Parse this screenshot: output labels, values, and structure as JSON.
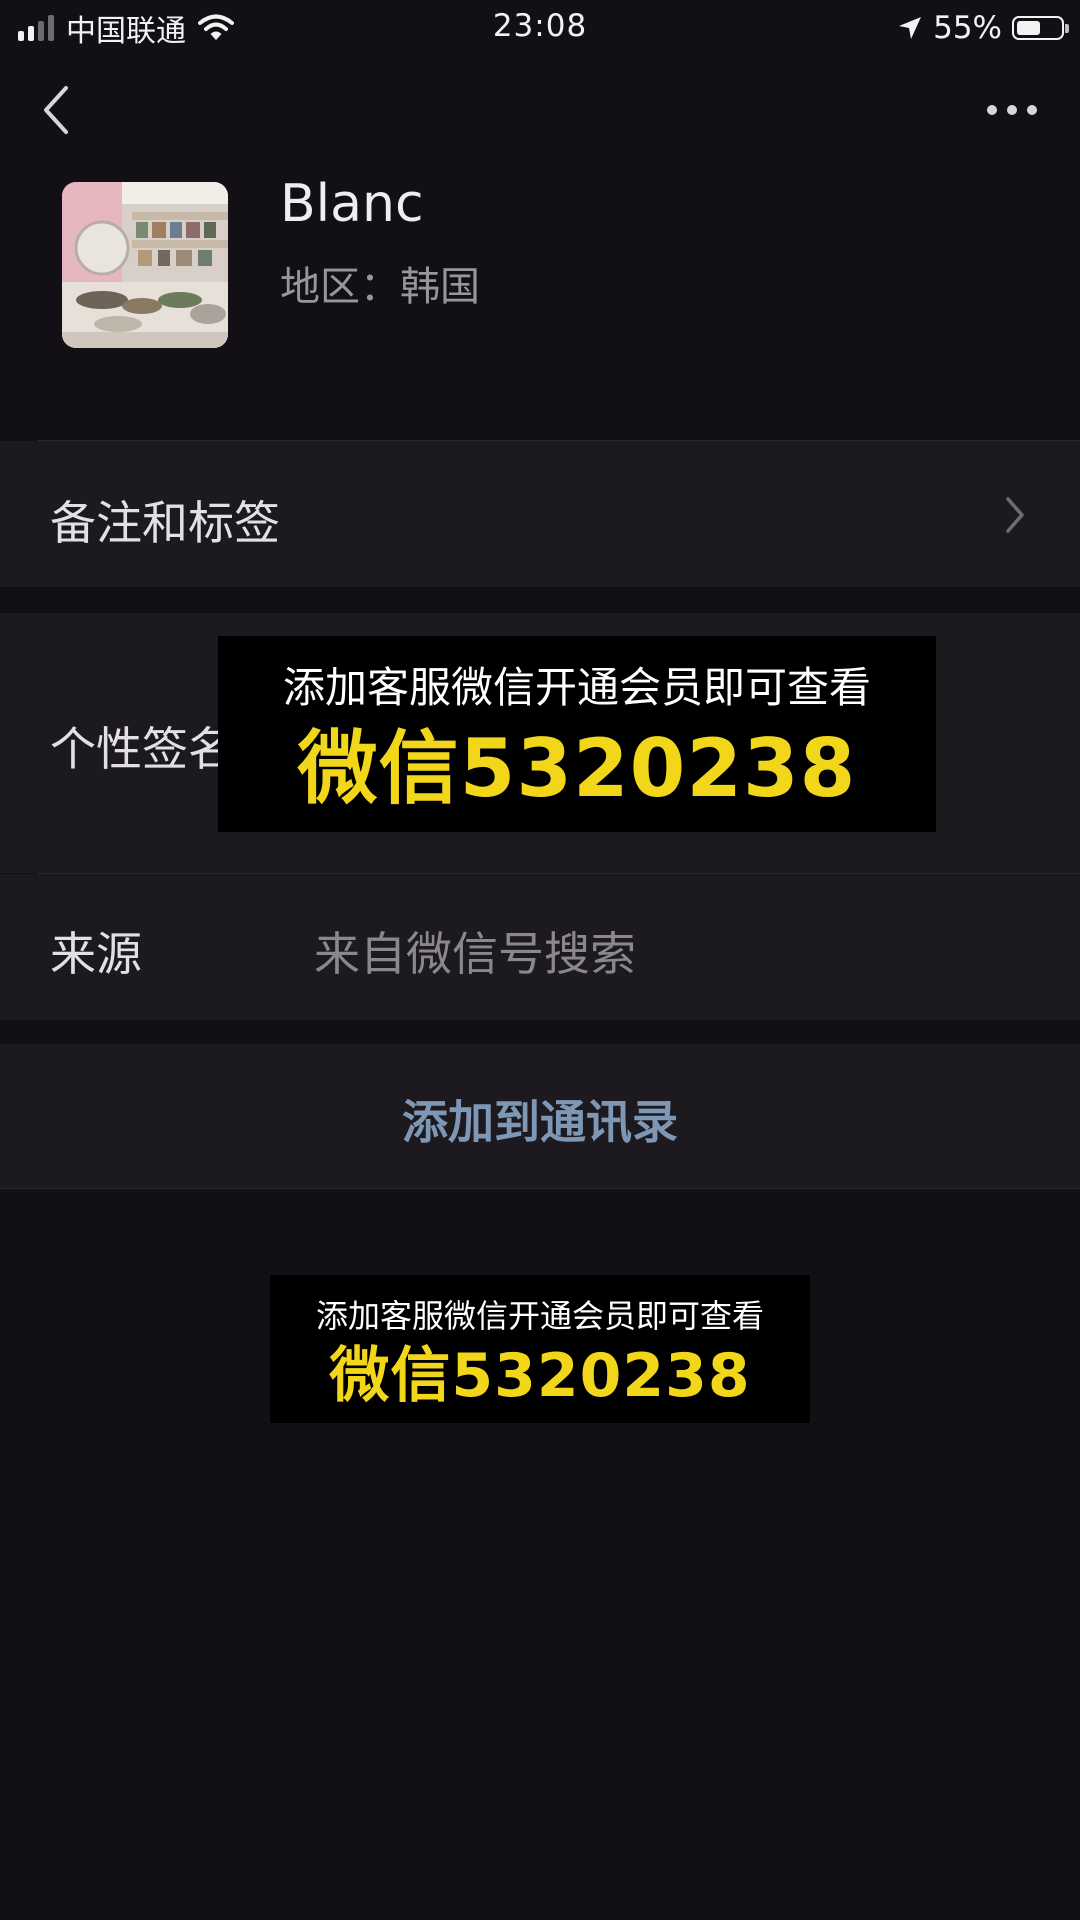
{
  "status_bar": {
    "carrier": "中国联通",
    "time": "23:08",
    "battery": "55%",
    "battery_level": 0.55,
    "icons": [
      "signal-icon",
      "wifi-icon",
      "location-arrow-icon",
      "battery-icon"
    ]
  },
  "nav": {
    "back_icon": "chevron-left-icon",
    "more_icon": "ellipsis-icon"
  },
  "profile": {
    "name": "Blanc",
    "region": "地区：韩国"
  },
  "rows": {
    "remark_label": "备注和标签",
    "signature_label": "个性签名",
    "source_label": "来源",
    "source_value": "来自微信号搜索"
  },
  "add_button": {
    "label": "添加到通讯录"
  },
  "promo_top": {
    "line1": "添加客服微信开通会员即可查看",
    "line2": "微信5320238"
  },
  "promo_bottom": {
    "line1": "添加客服微信开通会员即可查看",
    "line2": "微信5320238"
  },
  "colors": {
    "background": "#131015",
    "row_background": "#1d1a1f",
    "link_blue": "#7e97b5",
    "promo_yellow": "#f2d61a"
  }
}
